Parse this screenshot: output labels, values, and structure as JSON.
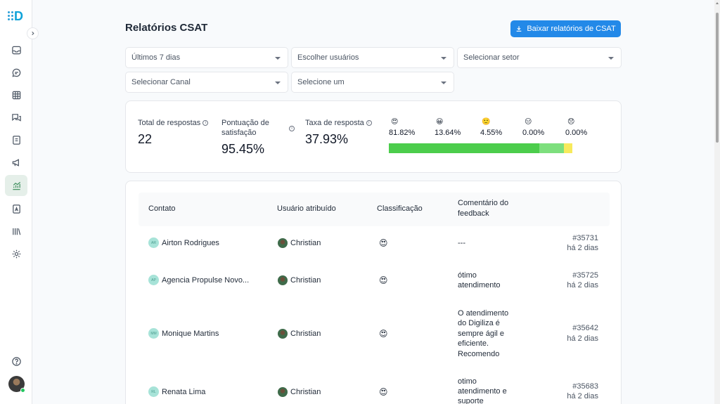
{
  "sidebar": {
    "logo_letter": "D",
    "items": [
      {
        "icon": "inbox-icon"
      },
      {
        "icon": "chat-bubble-icon"
      },
      {
        "icon": "table-grid-icon"
      },
      {
        "icon": "conversations-icon"
      },
      {
        "icon": "contacts-book-icon"
      },
      {
        "icon": "megaphone-icon"
      },
      {
        "icon": "reports-chart-icon",
        "active": true
      },
      {
        "icon": "document-a-icon"
      },
      {
        "icon": "library-icon"
      },
      {
        "icon": "gear-icon"
      }
    ],
    "help_icon": "help-circle-icon"
  },
  "header": {
    "title": "Relatórios CSAT",
    "download_label": "Baixar relatórios de CSAT"
  },
  "filters": {
    "period": "Últimos 7 dias",
    "users": "Escolher usuários",
    "sector": "Selecionar setor",
    "channel": "Selecionar Canal",
    "other": "Selecione um"
  },
  "stats": {
    "total_label": "Total de respostas",
    "total_value": "22",
    "score_label_1": "Pontuação de",
    "score_label_2": "satisfação",
    "score_value": "95.45%",
    "rate_label": "Taxa de resposta",
    "rate_value": "37.93%",
    "distribution": [
      {
        "emoji": "😍",
        "pct": "81.82%",
        "value": 81.82,
        "color": "#4ccd4c"
      },
      {
        "emoji": "😀",
        "pct": "13.64%",
        "value": 13.64,
        "color": "#7ddf7d"
      },
      {
        "emoji": "🙂",
        "pct": "4.55%",
        "value": 4.55,
        "color": "#f7ea5c"
      },
      {
        "emoji": "😑",
        "pct": "0.00%",
        "value": 0,
        "color": "#f5a442"
      },
      {
        "emoji": "😞",
        "pct": "0.00%",
        "value": 0,
        "color": "#ef5350"
      }
    ]
  },
  "table": {
    "headers": {
      "contact": "Contato",
      "assigned": "Usuário atribuído",
      "rating": "Classificação",
      "comment_1": "Comentário do",
      "comment_2": "feedback"
    },
    "rows": [
      {
        "initials": "AR",
        "name": "Airton Rodrigues",
        "agent": "Christian",
        "rating": "😍",
        "comment": [
          "---"
        ],
        "ticket": "#35731",
        "time": "há 2 dias"
      },
      {
        "initials": "AP",
        "name": "Agencia Propulse Novo...",
        "agent": "Christian",
        "rating": "😍",
        "comment": [
          "ótimo",
          "atendimento"
        ],
        "ticket": "#35725",
        "time": "há 2 dias"
      },
      {
        "initials": "MM",
        "name": "Monique Martins",
        "agent": "Christian",
        "rating": "😍",
        "comment": [
          "O atendimento",
          "do Digiliza é",
          "sempre ágil e",
          "eficiente.",
          "Recomendo"
        ],
        "ticket": "#35642",
        "time": "há 2 dias"
      },
      {
        "initials": "RL",
        "name": "Renata Lima",
        "agent": "Christian",
        "rating": "😍",
        "comment": [
          "otimo",
          "atendimento e",
          "suporte"
        ],
        "ticket": "#35683",
        "time": "há 2 dias"
      }
    ]
  }
}
